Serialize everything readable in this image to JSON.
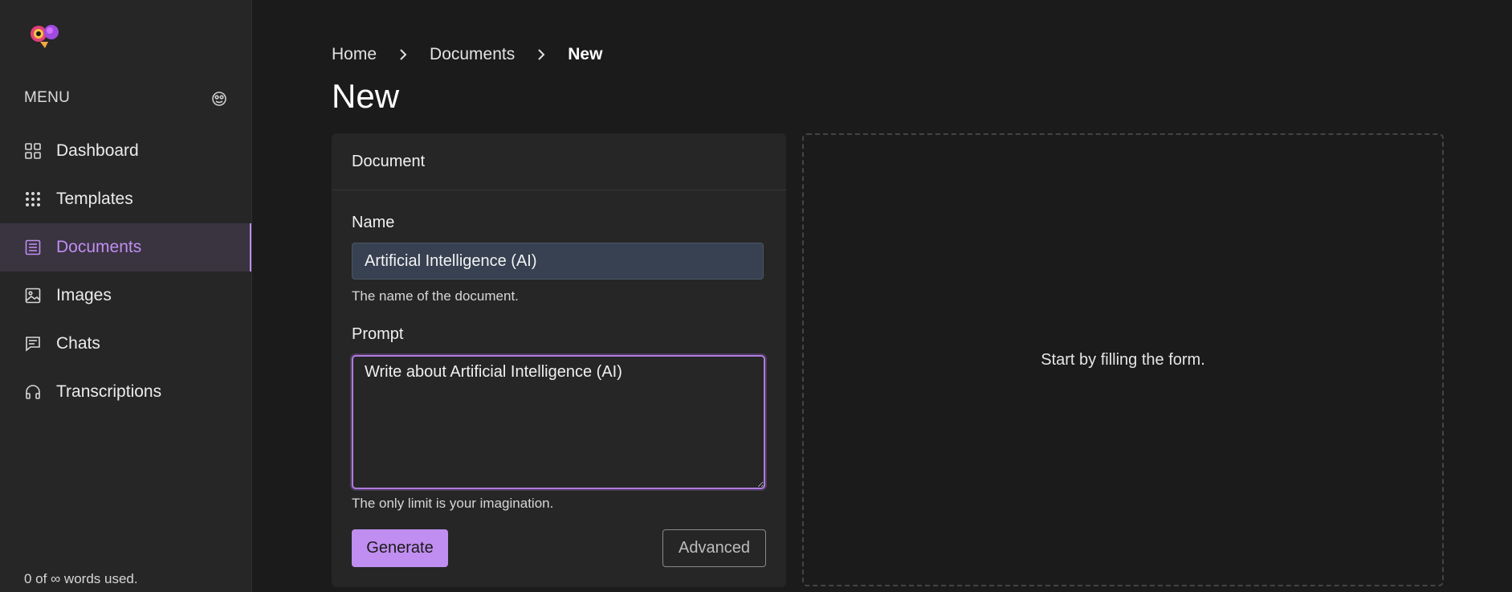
{
  "sidebar": {
    "menu_title": "MENU",
    "items": [
      {
        "label": "Dashboard",
        "icon": "grid-icon",
        "active": false
      },
      {
        "label": "Templates",
        "icon": "dots-grid-icon",
        "active": false
      },
      {
        "label": "Documents",
        "icon": "document-icon",
        "active": true
      },
      {
        "label": "Images",
        "icon": "image-icon",
        "active": false
      },
      {
        "label": "Chats",
        "icon": "chat-icon",
        "active": false
      },
      {
        "label": "Transcriptions",
        "icon": "headphones-icon",
        "active": false
      }
    ],
    "usage": "0 of ∞ words used."
  },
  "breadcrumb": [
    "Home",
    "Documents",
    "New"
  ],
  "page_title": "New",
  "form": {
    "header": "Document",
    "name_label": "Name",
    "name_value": "Artificial Intelligence (AI)",
    "name_help": "The name of the document.",
    "prompt_label": "Prompt",
    "prompt_value": "Write about Artificial Intelligence (AI)",
    "prompt_help": "The only limit is your imagination.",
    "generate_label": "Generate",
    "advanced_label": "Advanced"
  },
  "preview": {
    "empty_text": "Start by filling the form."
  },
  "colors": {
    "accent": "#c08ef0",
    "background": "#1b1b1b",
    "sidebar": "#262626"
  }
}
